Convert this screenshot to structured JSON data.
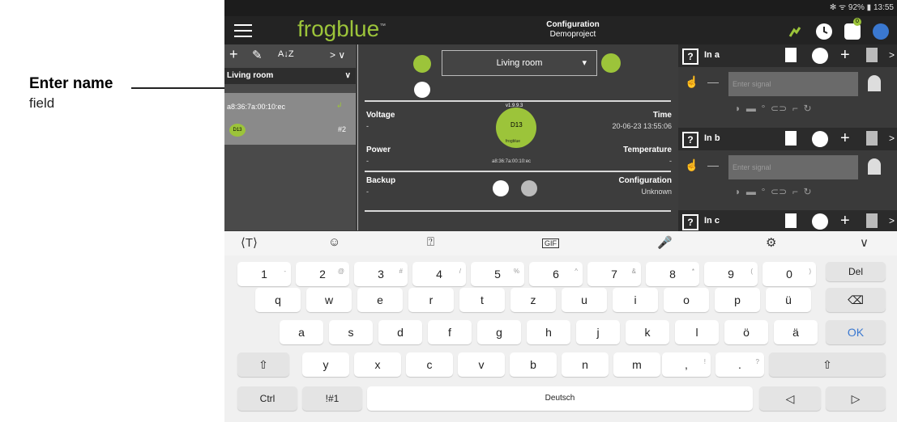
{
  "callout": {
    "title": "Enter name",
    "subtitle": "field"
  },
  "statusbar": {
    "text": "✻ ᯤ 92% ▮ 13:55"
  },
  "appbar": {
    "logo": "frogblue",
    "logo_tm": "™",
    "title": "Configuration",
    "subtitle": "Demoproject",
    "badge": "0"
  },
  "left": {
    "add": "+",
    "edit": "✎",
    "sort": "A↓Z",
    "expand": "> ∨",
    "room": "Living room",
    "room_chevron": "∨",
    "mac": "a8:36:7a:00:10:ec",
    "device_label": "D13",
    "device_num": "#2"
  },
  "mid": {
    "dropdown": "Living room",
    "dropdown_arrow": "▾",
    "voltage": {
      "label": "Voltage",
      "value": "-"
    },
    "time": {
      "label": "Time",
      "value": "20-06-23 13:55:06"
    },
    "power": {
      "label": "Power",
      "value": "-"
    },
    "temperature": {
      "label": "Temperature",
      "value": "-"
    },
    "backup": {
      "label": "Backup",
      "value": "-"
    },
    "configuration": {
      "label": "Configuration",
      "value": "Unknown"
    },
    "device": {
      "version": "v1.9.9.3",
      "name": "D13",
      "brand": "frogblue",
      "mac": "a8:36:7a:00:10:ec"
    }
  },
  "right": {
    "blocks": [
      {
        "name": "In a",
        "placeholder": "Enter signal"
      },
      {
        "name": "In b",
        "placeholder": "Enter signal"
      },
      {
        "name": "In c",
        "placeholder": ""
      }
    ],
    "minus": "—",
    "help": "?",
    "plus": "+",
    "more": ">"
  },
  "toolbar": {
    "translate": "⟨T⟩",
    "emoji": "☺",
    "sticker": "⍰",
    "gif": "GIF",
    "mic": "🎤",
    "settings": "⚙",
    "hide": "∨"
  },
  "keyboard": {
    "row1": [
      [
        "1",
        "-"
      ],
      [
        "2",
        "@"
      ],
      [
        "3",
        "#"
      ],
      [
        "4",
        "/"
      ],
      [
        "5",
        "%"
      ],
      [
        "6",
        "^"
      ],
      [
        "7",
        "&"
      ],
      [
        "8",
        "*"
      ],
      [
        "9",
        "("
      ],
      [
        "0",
        ")"
      ]
    ],
    "del": "Del",
    "row2": [
      "q",
      "w",
      "e",
      "r",
      "t",
      "z",
      "u",
      "i",
      "o",
      "p",
      "ü"
    ],
    "backspace": "⌫",
    "row3": [
      "a",
      "s",
      "d",
      "f",
      "g",
      "h",
      "j",
      "k",
      "l",
      "ö",
      "ä"
    ],
    "ok": "OK",
    "row4": [
      "y",
      "x",
      "c",
      "v",
      "b",
      "n",
      "m"
    ],
    "comma": ",",
    "comma_alt": "!",
    "period": ".",
    "period_alt": "?",
    "shift": "⇧",
    "ctrl": "Ctrl",
    "symbols": "!#1",
    "space": "Deutsch",
    "left": "◁",
    "right": "▷"
  },
  "colors": {
    "accent": "#9cc43a",
    "panel": "#3a3a3a",
    "dark": "#232323"
  }
}
